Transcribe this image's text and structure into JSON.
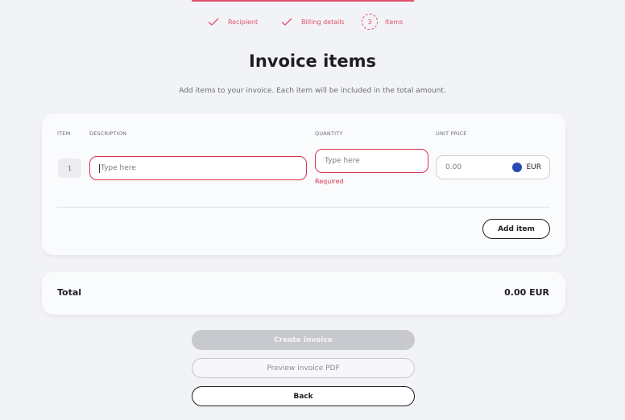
{
  "stepper": {
    "steps": [
      {
        "label": "Recipient",
        "state": "done"
      },
      {
        "label": "Billing details",
        "state": "done"
      },
      {
        "label": "Items",
        "number": "3",
        "state": "current"
      }
    ]
  },
  "header": {
    "title": "Invoice items",
    "subtitle": "Add items to your invoice. Each item will be included in the total amount."
  },
  "items_table": {
    "columns": {
      "item": "ITEM",
      "description": "DESCRIPTION",
      "quantity": "QUANTITY",
      "unit_price": "UNIT PRICE"
    },
    "rows": [
      {
        "number": "1",
        "description_placeholder": "Type here",
        "quantity_placeholder": "Type here",
        "quantity_error": "Required",
        "unit_price_value": "0.00",
        "currency": "EUR"
      }
    ],
    "add_item_label": "Add item"
  },
  "total": {
    "label": "Total",
    "value": "0.00 EUR"
  },
  "actions": {
    "create_label": "Create invoice",
    "preview_label": "Preview invoice PDF",
    "back_label": "Back"
  },
  "colors": {
    "accent": "#e0526a",
    "error": "#d9334d",
    "currency_dot": "#2c4ab0"
  }
}
